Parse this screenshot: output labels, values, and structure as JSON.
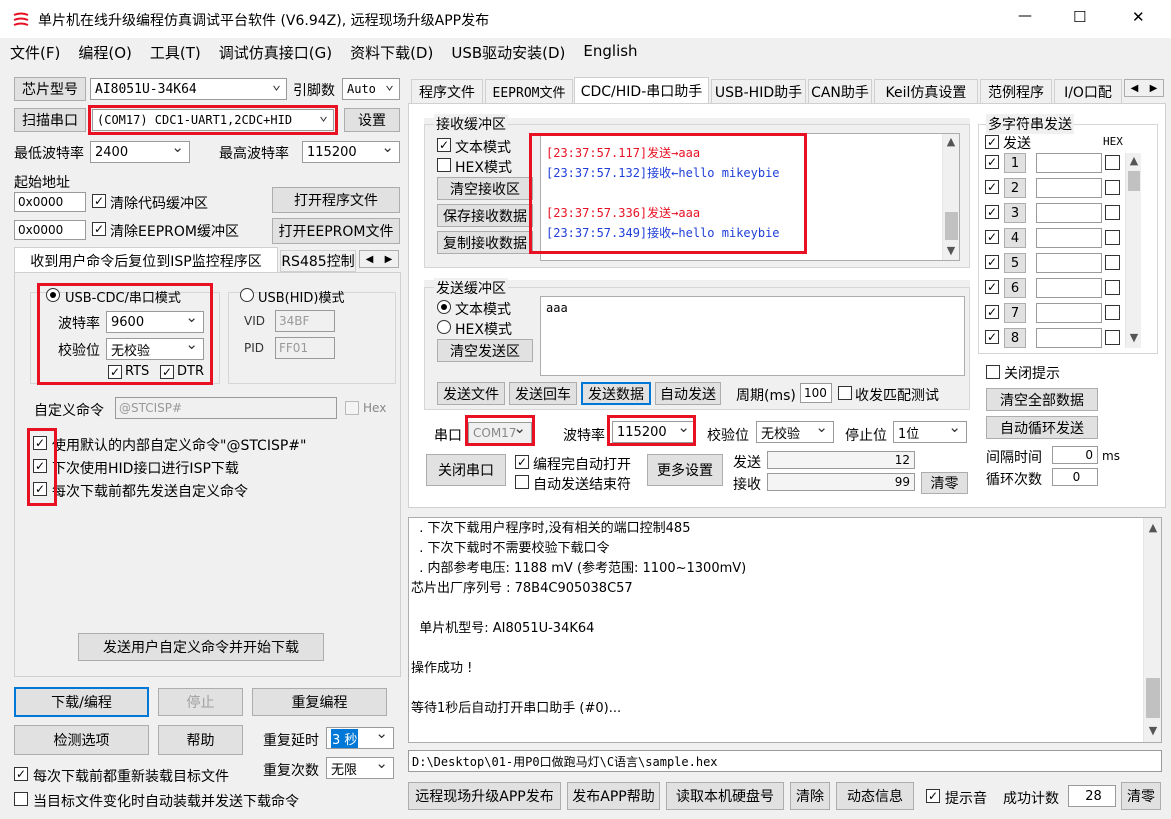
{
  "window": {
    "title": "单片机在线升级编程仿真调试平台软件 (V6.94Z), 远程现场升级APP发布",
    "min": "—",
    "max": "☐",
    "close": "✕"
  },
  "menu": [
    "文件(F)",
    "编程(O)",
    "工具(T)",
    "调试仿真接口(G)",
    "资料下载(D)",
    "USB驱动安装(D)",
    "English"
  ],
  "left": {
    "chip_btn": "芯片型号",
    "chip_value": "AI8051U-34K64",
    "pin_label": "引脚数",
    "pin_value": "Auto",
    "scan_btn": "扫描串口",
    "port_value": "(COM17) CDC1-UART1,2CDC+HID",
    "settings_btn": "设置",
    "min_baud_label": "最低波特率",
    "min_baud_value": "2400",
    "max_baud_label": "最高波特率",
    "max_baud_value": "115200",
    "start_addr_label": "起始地址",
    "addr1": "0x0000",
    "clear_code": "清除代码缓冲区",
    "open_prog": "打开程序文件",
    "addr2": "0x0000",
    "clear_eeprom": "清除EEPROM缓冲区",
    "open_eeprom": "打开EEPROM文件",
    "tab_isp": "收到用户命令后复位到ISP监控程序区",
    "tab_rs485": "RS485控制",
    "mode_cdc": "USB-CDC/串口模式",
    "mode_hid": "USB(HID)模式",
    "baud_label": "波特率",
    "baud_value": "9600",
    "parity_label": "校验位",
    "parity_value": "无校验",
    "vid_label": "VID",
    "vid_value": "34BF",
    "pid_label": "PID",
    "pid_value": "FF01",
    "rts": "RTS",
    "dtr": "DTR",
    "custom_cmd_label": "自定义命令",
    "custom_cmd_value": "@STCISP#",
    "hex_label": "Hex",
    "opt1": "使用默认的内部自定义命令\"@STCISP#\"",
    "opt2": "下次使用HID接口进行ISP下载",
    "opt3": "每次下载前都先发送自定义命令",
    "send_cmd_btn": "发送用户自定义命令并开始下载",
    "download_btn": "下载/编程",
    "stop_btn": "停止",
    "reprog_btn": "重复编程",
    "check_btn": "检测选项",
    "help_btn": "帮助",
    "delay_label": "重复延时",
    "delay_value": "3 秒",
    "repeat_label": "重复次数",
    "repeat_value": "无限",
    "reload1": "每次下载前都重新装载目标文件",
    "reload2": "当目标文件变化时自动装载并发送下载命令"
  },
  "tabs": [
    "程序文件",
    "EEPROM文件",
    "CDC/HID-串口助手",
    "USB-HID助手",
    "CAN助手",
    "Keil仿真设置",
    "范例程序",
    "I/O口配"
  ],
  "recv": {
    "group": "接收缓冲区",
    "text_mode": "文本模式",
    "hex_mode": "HEX模式",
    "clear": "清空接收区",
    "save": "保存接收数据",
    "copy": "复制接收数据",
    "lines": [
      {
        "time": "[23:37:57.117]",
        "dir": "发送→",
        "text": "aaa",
        "color": "#e81123"
      },
      {
        "time": "[23:37:57.132]",
        "dir": "接收←",
        "text": "hello mikeybie",
        "color": "#1f3fd8"
      },
      {
        "time": "[23:37:57.336]",
        "dir": "发送→",
        "text": "aaa",
        "color": "#e81123"
      },
      {
        "time": "[23:37:57.349]",
        "dir": "接收←",
        "text": "hello mikeybie",
        "color": "#1f3fd8"
      }
    ]
  },
  "send": {
    "group": "发送缓冲区",
    "text_mode": "文本模式",
    "hex_mode": "HEX模式",
    "clear": "清空发送区",
    "content": "aaa",
    "send_file": "发送文件",
    "send_enter": "发送回车",
    "send_data": "发送数据",
    "auto_send": "自动发送",
    "period_label": "周期(ms)",
    "period_value": "100",
    "match_test": "收发匹配测试"
  },
  "serial": {
    "port_label": "串口",
    "port_value": "COM17",
    "baud_label": "波特率",
    "baud_value": "115200",
    "parity_label": "校验位",
    "parity_value": "无校验",
    "stop_label": "停止位",
    "stop_value": "1位",
    "close_btn": "关闭串口",
    "auto_open": "编程完自动打开",
    "auto_end": "自动发送结束符",
    "more": "更多设置",
    "sent_label": "发送",
    "sent_value": "12",
    "recv_label": "接收",
    "recv_value": "99",
    "clear": "清零"
  },
  "multi": {
    "group": "多字符串发送",
    "send_label": "发送",
    "hex_label": "HEX",
    "rows": [
      "1",
      "2",
      "3",
      "4",
      "5",
      "6",
      "7",
      "8"
    ],
    "close_tip": "关闭提示",
    "clear_all": "清空全部数据",
    "auto_loop": "自动循环发送",
    "interval_label": "间隔时间",
    "interval_value": "0",
    "interval_unit": "ms",
    "loop_label": "循环次数",
    "loop_value": "0"
  },
  "log": {
    "lines": [
      "  . 下次下载用户程序时,没有相关的端口控制485",
      "  . 下次下载时不需要校验下载口令",
      "  . 内部参考电压: 1188 mV (参考范围: 1100~1300mV)",
      "芯片出厂序列号 : 78B4C905038C57",
      "",
      "  单片机型号: AI8051U-34K64",
      "",
      "操作成功 !",
      "",
      "等待1秒后自动打开串口助手 (#0)..."
    ]
  },
  "path": "D:\\Desktop\\01-用P0口做跑马灯\\C语言\\sample.hex",
  "bottom": {
    "remote_btn": "远程现场升级APP发布",
    "app_help_btn": "发布APP帮助",
    "read_disk_btn": "读取本机硬盘号",
    "clear_btn": "清除",
    "anim_btn": "动态信息",
    "beep": "提示音",
    "success_label": "成功计数",
    "success_value": "28",
    "clear2_btn": "清零"
  }
}
